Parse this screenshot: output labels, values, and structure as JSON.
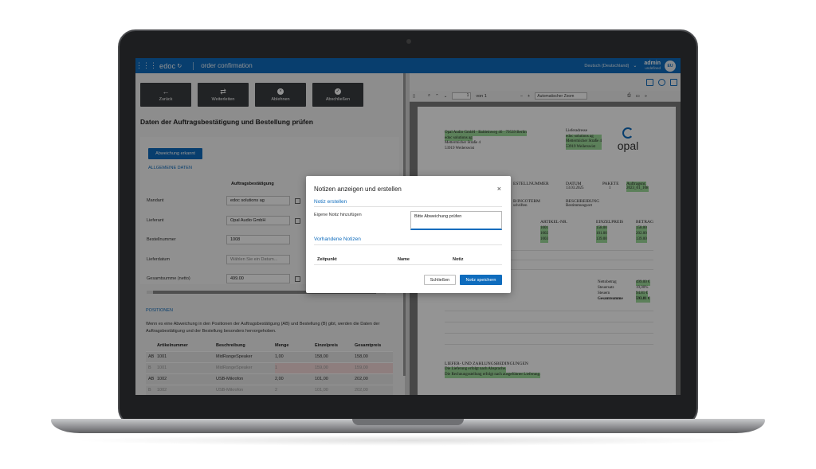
{
  "topbar": {
    "brand": "edoc",
    "document_title": "order confirmation",
    "language": "Deutsch (Deutschland)",
    "user_name": "admin",
    "user_sub": "undefined",
    "avatar_initials": "EU"
  },
  "toolbar": {
    "back": "Zurück",
    "forward": "Weiterleiten",
    "reject": "Ablehnen",
    "complete": "Abschließen"
  },
  "left": {
    "heading": "Daten der Auftragsbestätigung und Bestellung prüfen",
    "deviation_button": "Abweichung erkannt",
    "general_section": "ALLGEMEINE DATEN",
    "column_header": "Auftragsbestätigung",
    "fields": [
      {
        "label": "Mandant",
        "value": "edoc solutions ag"
      },
      {
        "label": "Lieferant",
        "value": "Opal Audio GmbH"
      },
      {
        "label": "Bestellnummer",
        "value": "1008"
      },
      {
        "label": "Lieferdatum",
        "placeholder": "Wählen Sie ein Datum..."
      },
      {
        "label": "Gesamtsumme (netto)",
        "value": "499.00"
      }
    ],
    "positions_section": "POSITIONEN",
    "positions_desc": "Wenn es eine Abweichung in den Positionen der Auftragsbestätigung (AB) und Bestellung (B) gibt, werden die Daten der Auftragsbestätigung und der Bestellung besonders hervorgehoben.",
    "positions_headers": [
      "",
      "Artikelnummer",
      "Beschreibung",
      "Menge",
      "Einzelpreis",
      "Gesamtpreis"
    ],
    "positions_rows": [
      [
        "AB",
        "1001",
        "MidRangeSpeaker",
        "1,00",
        "158,00",
        "158,00"
      ],
      [
        "B",
        "1001",
        "MidRangeSpeaker",
        "1",
        "159,00",
        "159,00"
      ],
      [
        "AB",
        "1002",
        "USB-Mikrofon",
        "2,00",
        "101,00",
        "202,00"
      ],
      [
        "B",
        "1002",
        "USB-Mikrofon",
        "2",
        "101,00",
        "202,00"
      ]
    ]
  },
  "pdf": {
    "page_number": "1",
    "page_of": "von 1",
    "zoom": "Automatischer Zoom",
    "sender_line": "Opal Audio GmbH · Baldeinweg 46 · 79539 Berlin",
    "recipient": [
      "edoc solutions ag",
      "Mettermicher Straße 4",
      "53919 Weilerswist"
    ],
    "delivery_title": "Lieferadresse",
    "delivery": [
      "edoc solutions ag",
      "Mettermicher Straße 4",
      "53919 Weilerswist"
    ],
    "logo_text": "opal",
    "meta_labels": [
      "ESTELLNUMMER",
      "DATUM",
      "PAKETE",
      "Auftragsnr."
    ],
    "meta_values": [
      "",
      "13.03.2025",
      "1",
      "2023_01_108"
    ],
    "terms_labels": [
      "B/INCOTERM",
      "BESCHREIBUNG"
    ],
    "terms_values": [
      "schriften",
      "Bestimmungsort"
    ],
    "items_headers": [
      "ARTIKEL-NR.",
      "EINZELPREIS",
      "BETRAG"
    ],
    "items": [
      [
        "1001",
        "158.00",
        "158.00"
      ],
      [
        "1002",
        "101.00",
        "202.00"
      ],
      [
        "1003",
        "139.00",
        "139.00"
      ]
    ],
    "totals": [
      [
        "Nettobetrag",
        "499.00 €"
      ],
      [
        "Steuersatz",
        "19,00%"
      ],
      [
        "Steuern",
        "94.81 €"
      ],
      [
        "Gesamtsumme",
        "593.81 €"
      ]
    ],
    "footer_title": "LIEFER- UND ZAHLUNGSBEDINGUNGEN",
    "footer_lines": [
      "Die Lieferung erfolgt nach Absprache.",
      "Die Rechnungsstellung erfolgt nach ausgeführter Lieferung."
    ]
  },
  "modal": {
    "title": "Notizen anzeigen und erstellen",
    "close_icon": "close-icon",
    "create_section": "Notiz erstellen",
    "note_label": "Eigene Notiz hinzufügen",
    "note_value": "Bitte Abweichung prüfen",
    "existing_section": "Vorhandene Notizen",
    "col_time": "Zeitpunkt",
    "col_name": "Name",
    "col_note": "Notiz",
    "close_button": "Schließen",
    "save_button": "Notiz speichern"
  },
  "colors": {
    "brand_blue": "#0f6cbd",
    "toolbar_dark": "#3a3d41",
    "pdf_highlight": "#9fdc9c",
    "deviation_red": "#f4dada"
  }
}
